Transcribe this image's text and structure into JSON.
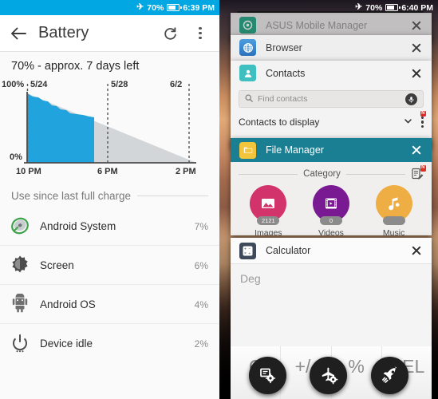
{
  "left_panel": {
    "statusbar": {
      "plane_icon": "airplane-mode-icon",
      "battery_pct": "70%",
      "battery_icon": "battery-icon",
      "time": "6:39 PM"
    },
    "appbar": {
      "back_icon": "back-arrow-icon",
      "title": "Battery",
      "refresh_icon": "refresh-icon",
      "overflow_icon": "overflow-menu-icon"
    },
    "summary": "70% - approx. 7 days left",
    "chart": {
      "y_top_label": "100%",
      "y_bottom_label": "0%",
      "x_left_label": "10 PM",
      "x_mid_label": "6 PM",
      "x_right_label": "2 PM",
      "date_labels": [
        "5/24",
        "5/28",
        "6/2"
      ],
      "history_color": "#21A3DD",
      "projection_color": "#d2d6d8"
    },
    "section_title": "Use since last full charge",
    "usage": [
      {
        "icon": "android-system-icon",
        "name": "Android System",
        "pct": "7%",
        "fill": 38
      },
      {
        "icon": "screen-brightness-icon",
        "name": "Screen",
        "pct": "6%",
        "fill": 33
      },
      {
        "icon": "android-robot-icon",
        "name": "Android OS",
        "pct": "4%",
        "fill": 23
      },
      {
        "icon": "power-idle-icon",
        "name": "Device idle",
        "pct": "2%",
        "fill": 15
      }
    ]
  },
  "right_panel": {
    "statusbar": {
      "plane_icon": "airplane-mode-icon",
      "battery_pct": "70%",
      "battery_icon": "battery-icon",
      "time": "6:40 PM"
    },
    "cards": {
      "asus": {
        "title": "ASUS Mobile Manager",
        "icon": "asus-mobile-manager-icon",
        "close": "close-icon"
      },
      "browser": {
        "title": "Browser",
        "icon": "browser-globe-icon",
        "close": "close-icon"
      },
      "contacts": {
        "title": "Contacts",
        "icon": "contacts-person-icon",
        "close": "close-icon",
        "search_placeholder": "Find contacts",
        "search_icon": "search-icon",
        "mic_icon": "microphone-icon",
        "display_label": "Contacts to display",
        "chevron": "chevron-down-icon",
        "overflow_icon": "overflow-menu-icon",
        "badge": "N"
      },
      "file_manager": {
        "title": "File Manager",
        "icon": "folder-icon",
        "close": "close-icon",
        "category_label": "Category",
        "note_icon": "note-edit-icon",
        "note_badge": "N",
        "header_color": "#1a7f92",
        "tiles": [
          {
            "label": "Images",
            "count": "2121",
            "color": "#d2336a",
            "icon": "image-icon"
          },
          {
            "label": "Videos",
            "count": "0",
            "color": "#7a1a93",
            "icon": "video-icon"
          },
          {
            "label": "Music",
            "count": "",
            "color": "#eeae44",
            "icon": "music-note-icon"
          }
        ]
      },
      "calculator": {
        "title": "Calculator",
        "icon": "calculator-icon",
        "close": "close-icon",
        "mode": "Deg",
        "keys": [
          "C",
          "+/-",
          "%",
          "DEL"
        ]
      }
    },
    "floating_buttons": [
      {
        "name": "screenshot-settings-icon"
      },
      {
        "name": "airplane-settings-icon"
      },
      {
        "name": "boost-rocket-icon"
      }
    ]
  }
}
